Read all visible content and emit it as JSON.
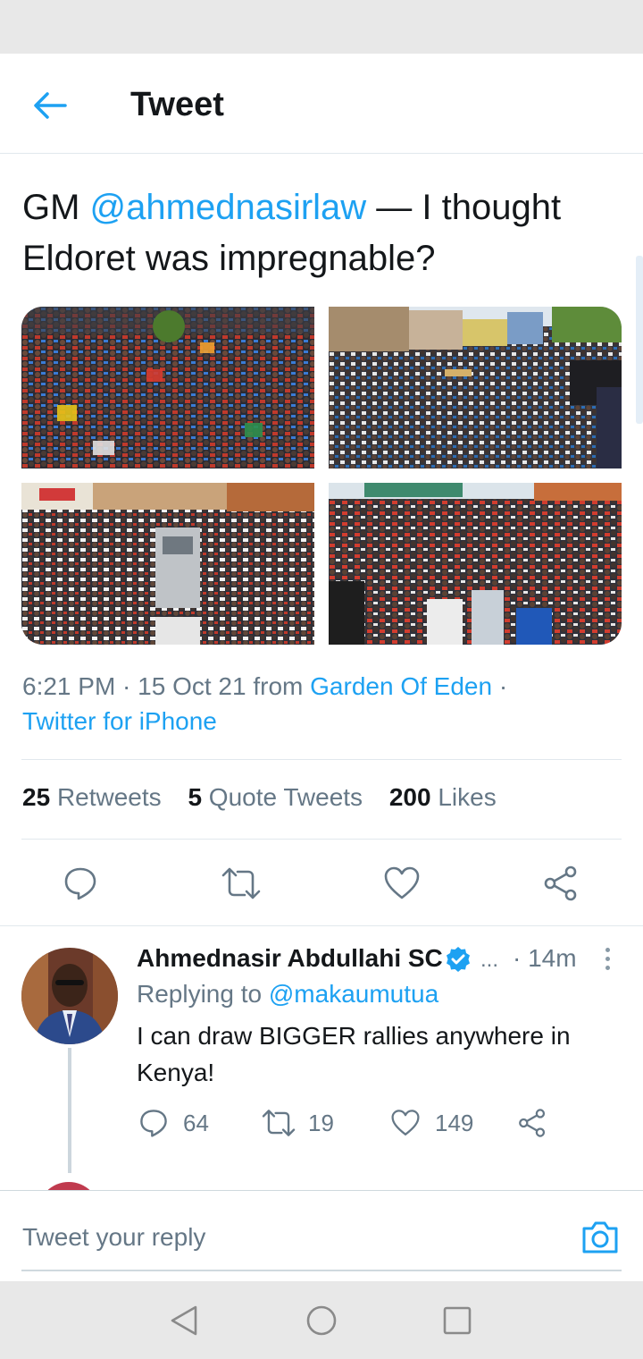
{
  "header": {
    "title": "Tweet"
  },
  "tweet": {
    "text_prefix": "GM ",
    "mention": "@ahmednasirlaw",
    "text_suffix": " — I thought Eldoret was impregnable?",
    "time": "6:21 PM",
    "date": "15 Oct 21",
    "from_label": "from",
    "location": "Garden Of Eden",
    "source": "Twitter for iPhone",
    "stats": {
      "retweets_count": "25",
      "retweets_label": "Retweets",
      "quotes_count": "5",
      "quotes_label": "Quote Tweets",
      "likes_count": "200",
      "likes_label": "Likes"
    }
  },
  "reply": {
    "name": "Ahmednasir Abdullahi SC",
    "name_ellipsis": "...",
    "time": "· 14m",
    "replying_label": "Replying to",
    "replying_to": "@makaumutua",
    "text": "I can draw BIGGER rallies anywhere in Kenya!",
    "replies": "64",
    "retweets": "19",
    "likes": "149"
  },
  "compose": {
    "placeholder": "Tweet your reply"
  },
  "colors": {
    "accent": "#1da1f2",
    "text_primary": "#14171a",
    "text_secondary": "#657786",
    "divider": "#e1e8ed"
  },
  "icons": {
    "back": "arrow-left-icon",
    "reply": "speech-bubble-icon",
    "retweet": "retweet-icon",
    "like": "heart-icon",
    "share": "share-icon",
    "verified": "verified-badge-icon",
    "camera": "camera-icon"
  }
}
